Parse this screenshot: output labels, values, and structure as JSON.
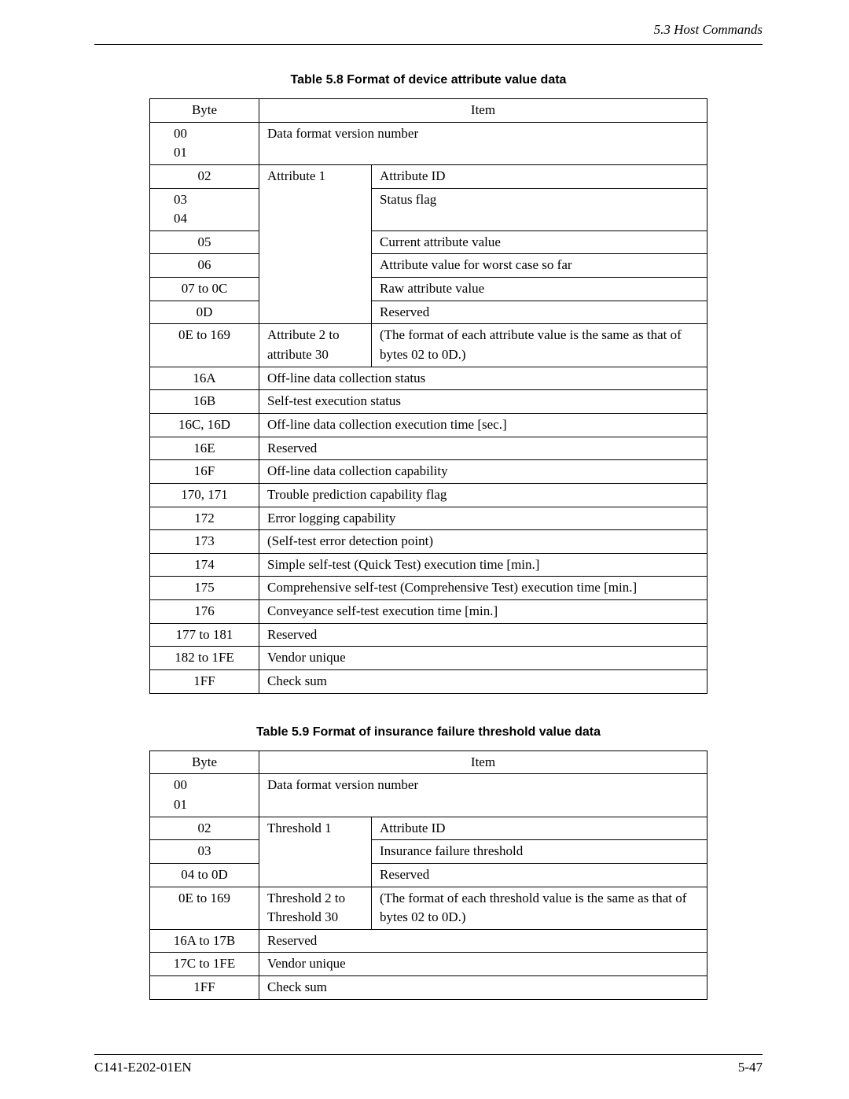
{
  "header": {
    "section": "5.3  Host Commands"
  },
  "table1": {
    "caption": "Table 5.8  Format of device attribute value data",
    "head_byte": "Byte",
    "head_item": "Item",
    "r1_byte": "00\n01",
    "r1_item": "Data format version number",
    "r2_byte": "02",
    "r2_attr": "Attribute 1",
    "r2_item": "Attribute ID",
    "r3_byte": "03\n04",
    "r3_item": "Status flag",
    "r4_byte": "05",
    "r4_item": "Current attribute value",
    "r5_byte": "06",
    "r5_item": "Attribute value for worst case so far",
    "r6_byte": "07 to 0C",
    "r6_item": "Raw attribute value",
    "r7_byte": "0D",
    "r7_item": "Reserved",
    "r8_byte": "0E to 169",
    "r8_attr": "Attribute 2 to attribute 30",
    "r8_item": "(The format of each attribute value is the same as that of bytes 02 to 0D.)",
    "r9_byte": "16A",
    "r9_item": "Off-line data collection status",
    "r10_byte": "16B",
    "r10_item": "Self-test execution status",
    "r11_byte": "16C, 16D",
    "r11_item": "Off-line data collection execution time [sec.]",
    "r12_byte": "16E",
    "r12_item": "Reserved",
    "r13_byte": "16F",
    "r13_item": "Off-line data collection capability",
    "r14_byte": "170, 171",
    "r14_item": "Trouble prediction capability flag",
    "r15_byte": "172",
    "r15_item": "Error logging capability",
    "r16_byte": "173",
    "r16_item": "(Self-test error detection point)",
    "r17_byte": "174",
    "r17_item": "Simple self-test (Quick Test) execution time [min.]",
    "r18_byte": "175",
    "r18_item": "Comprehensive self-test (Comprehensive Test) execution time [min.]",
    "r19_byte": "176",
    "r19_item": "Conveyance self-test execution time [min.]",
    "r20_byte": "177 to 181",
    "r20_item": "Reserved",
    "r21_byte": "182 to 1FE",
    "r21_item": "Vendor unique",
    "r22_byte": "1FF",
    "r22_item": "Check sum"
  },
  "table2": {
    "caption": "Table 5.9  Format of insurance failure threshold value data",
    "head_byte": "Byte",
    "head_item": "Item",
    "r1_byte": "00\n01",
    "r1_item": "Data format version number",
    "r2_byte": "02",
    "r2_attr": "Threshold 1",
    "r2_item": "Attribute ID",
    "r3_byte": "03",
    "r3_item": "Insurance failure threshold",
    "r4_byte": "04 to 0D",
    "r4_item": "Reserved",
    "r5_byte": "0E to 169",
    "r5_attr": "Threshold 2 to Threshold 30",
    "r5_item": "(The format of each threshold value is the same as that of bytes 02 to 0D.)",
    "r6_byte": "16A to 17B",
    "r6_item": "Reserved",
    "r7_byte": "17C to 1FE",
    "r7_item": "Vendor unique",
    "r8_byte": "1FF",
    "r8_item": "Check sum"
  },
  "footer": {
    "doc_id": "C141-E202-01EN",
    "page": "5-47"
  }
}
